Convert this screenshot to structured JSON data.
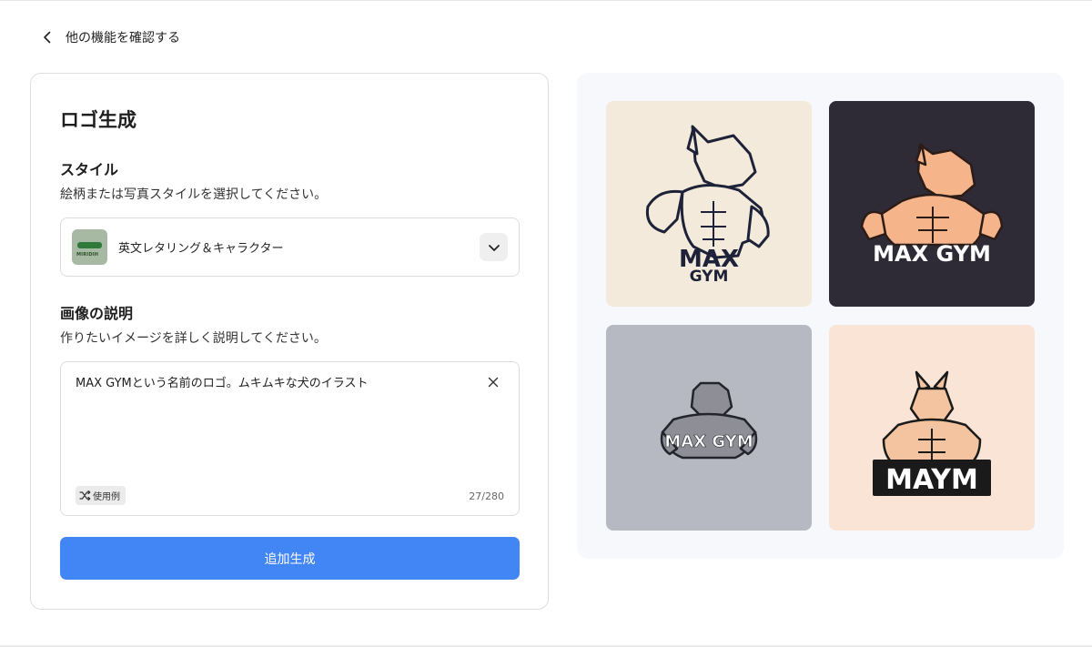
{
  "nav": {
    "back_label": "他の機能を確認する"
  },
  "panel": {
    "title": "ロゴ生成",
    "style_section": {
      "title": "スタイル",
      "description": "絵柄または写真スタイルを選択してください。",
      "selected_style": "英文レタリング＆キャラクター",
      "thumb_text": "MIRIDIH"
    },
    "description_section": {
      "title": "画像の説明",
      "description": "作りたいイメージを詳しく説明してください。",
      "input_value": "MAX GYMという名前のロゴ。ムキムキな犬のイラスト",
      "example_label": "使用例",
      "char_count": "27/280"
    },
    "generate_button": "追加生成"
  },
  "gallery": {
    "tiles": [
      {
        "text_line1": "MAX",
        "text_line2": "GYM",
        "bg": "#f3eadb"
      },
      {
        "text_line1": "MAX GYM",
        "bg": "#2e2b37"
      },
      {
        "text_line1": "MAX GYM",
        "bg": "#b7b9c2"
      },
      {
        "text_line1": "MAYM",
        "bg": "#f9e4d5"
      }
    ]
  }
}
